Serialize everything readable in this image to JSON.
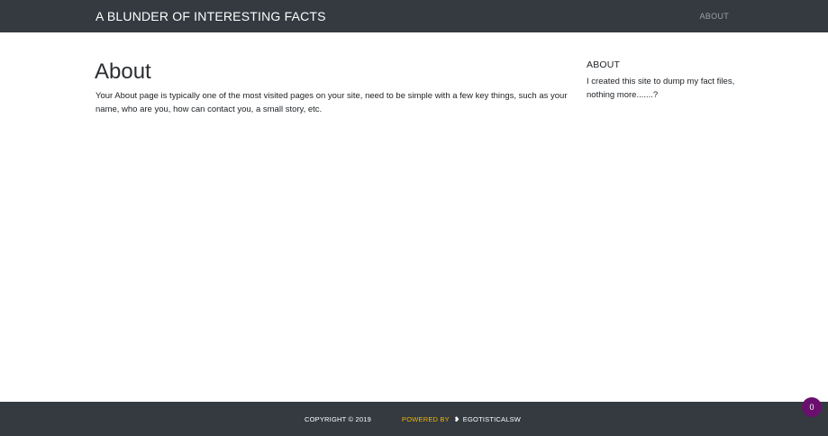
{
  "navbar": {
    "brand": "A BLUNDER OF INTERESTING FACTS",
    "links": [
      {
        "label": "ABOUT"
      }
    ]
  },
  "main": {
    "title": "About",
    "body": "Your About page is typically one of the most visited pages on your site, need to be simple with a few key things, such as your name, who are you, how can contact you, a small story, etc."
  },
  "sidebar": {
    "title": "ABOUT",
    "body": "I created this site to dump my fact files, nothing more.......?"
  },
  "footer": {
    "copyright": "COPYRIGHT © 2019",
    "powered_label": "POWERED BY",
    "powered_icon": "egotisticalsw-logo-icon",
    "powered_name": "EGOTISTICALSW"
  },
  "badge": {
    "count": "0"
  },
  "colors": {
    "navbar_bg": "#343a40",
    "footer_bg": "#343a40",
    "powered_accent": "#f0b400",
    "badge_bg": "#6a0f6d"
  }
}
